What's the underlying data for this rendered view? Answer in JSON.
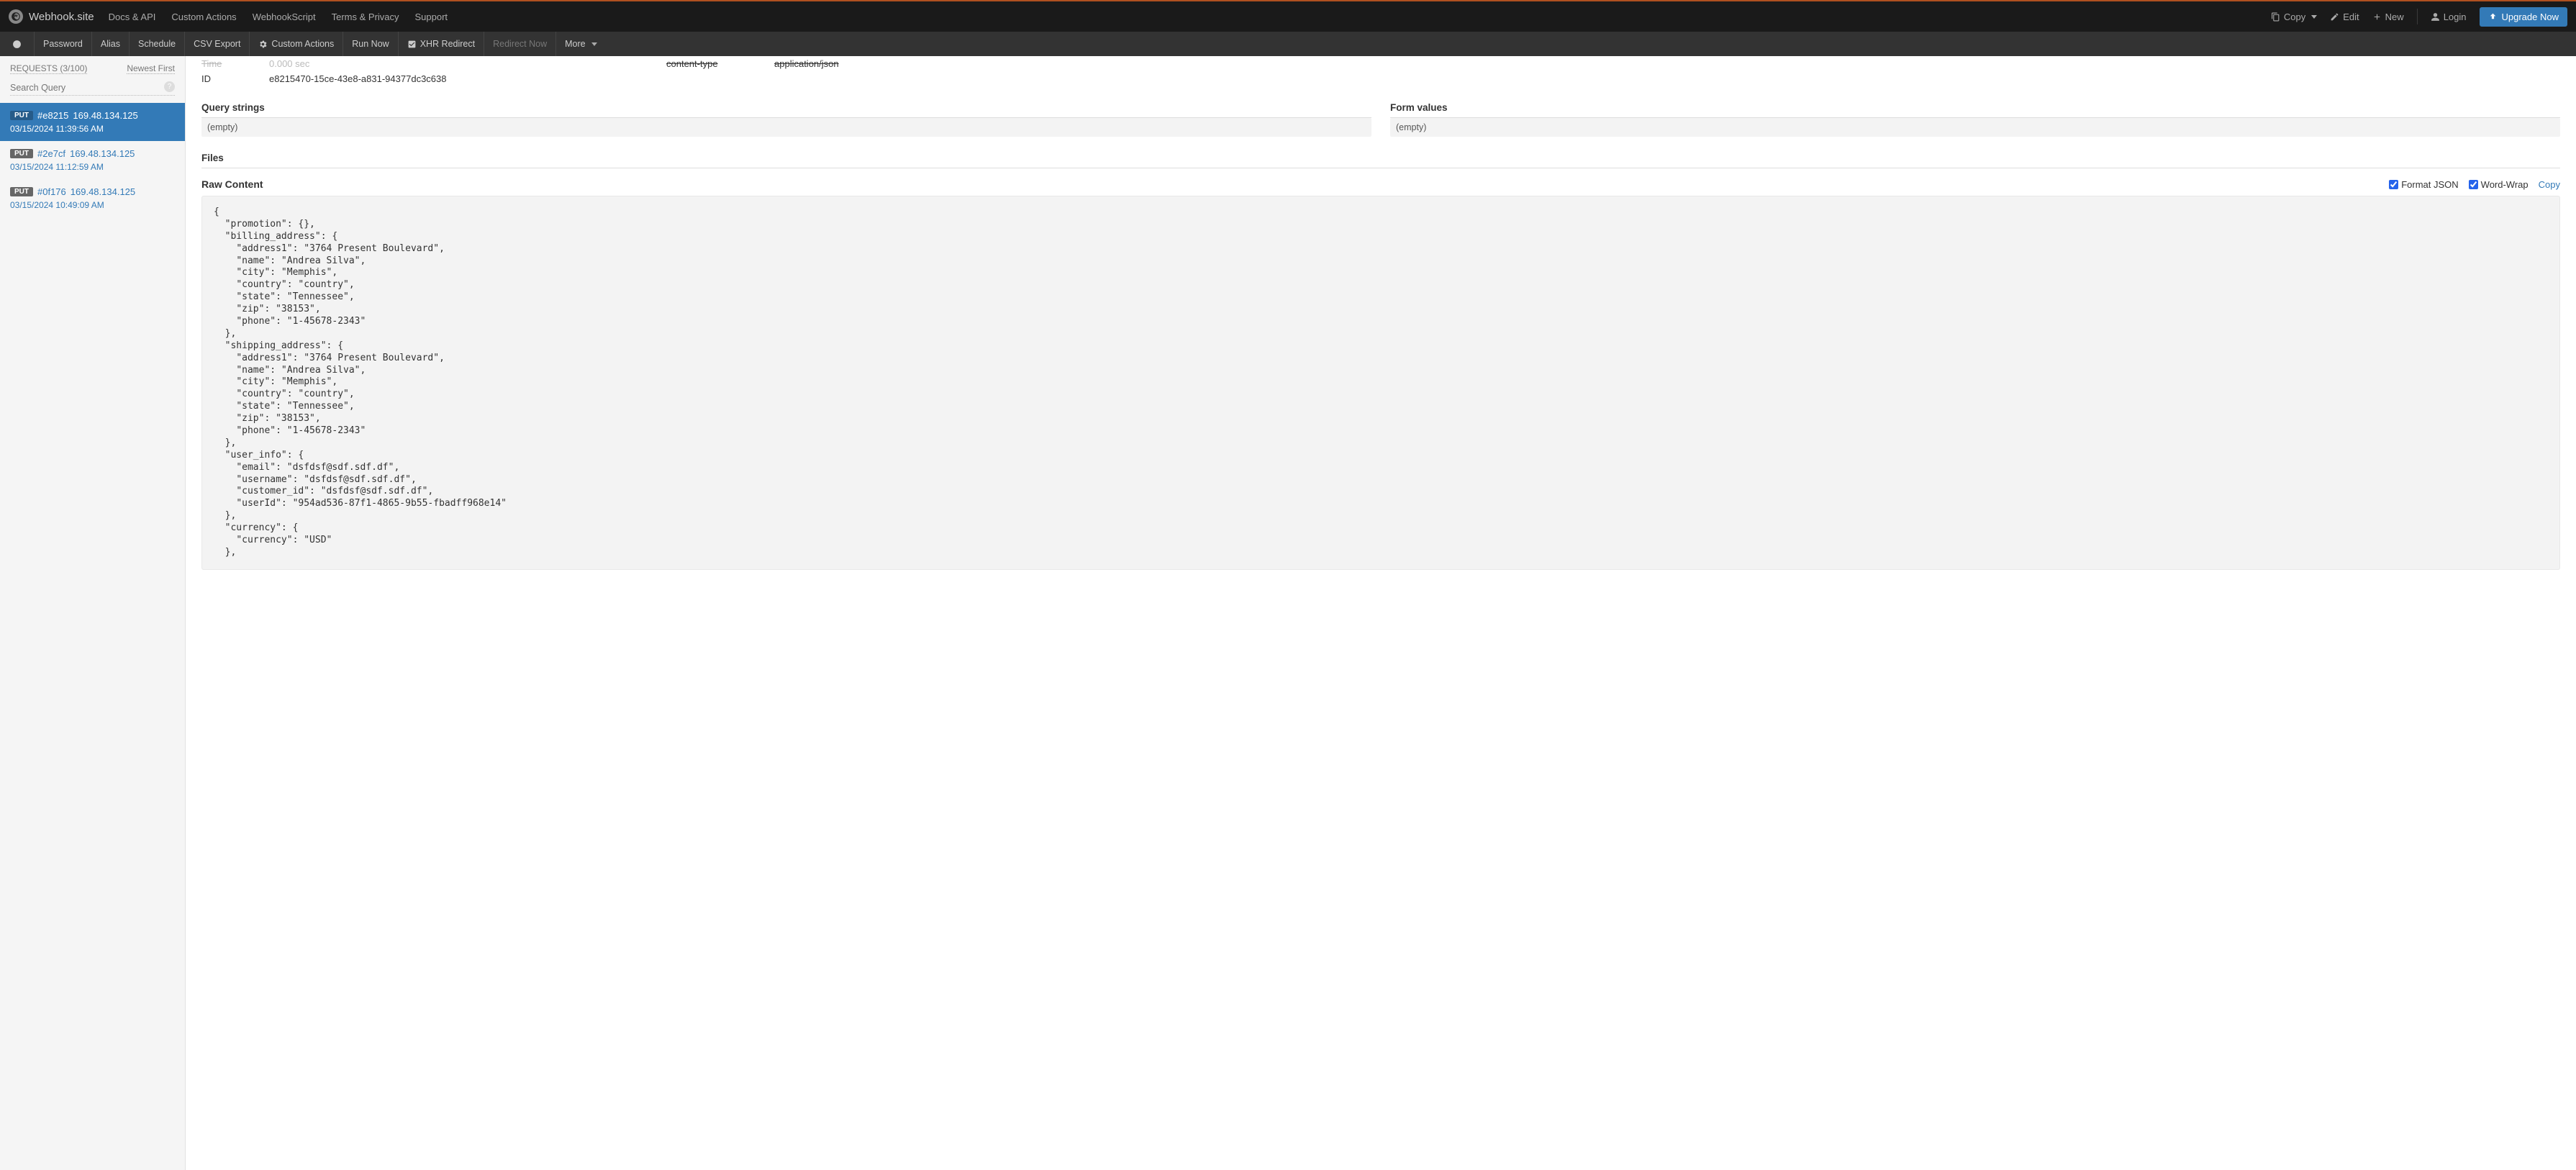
{
  "brand": "Webhook.site",
  "topnav": {
    "docs": "Docs & API",
    "custom_actions": "Custom Actions",
    "webhookscript": "WebhookScript",
    "terms": "Terms & Privacy",
    "support": "Support"
  },
  "topright": {
    "copy": "Copy",
    "edit": "Edit",
    "new": "New",
    "login": "Login",
    "upgrade": "Upgrade Now"
  },
  "secondbar": {
    "password": "Password",
    "alias": "Alias",
    "schedule": "Schedule",
    "csv_export": "CSV Export",
    "custom_actions": "Custom Actions",
    "run_now": "Run Now",
    "xhr_redirect": "XHR Redirect",
    "redirect_now": "Redirect Now",
    "more": "More"
  },
  "sidebar": {
    "requests_label": "REQUESTS (3/100)",
    "newest_first": "Newest First",
    "search_placeholder": "Search Query",
    "items": [
      {
        "method": "PUT",
        "hash": "#e8215",
        "ip": "169.48.134.125",
        "time": "03/15/2024 11:39:56 AM",
        "active": true
      },
      {
        "method": "PUT",
        "hash": "#2e7cf",
        "ip": "169.48.134.125",
        "time": "03/15/2024 11:12:59 AM",
        "active": false
      },
      {
        "method": "PUT",
        "hash": "#0f176",
        "ip": "169.48.134.125",
        "time": "03/15/2024 10:49:09 AM",
        "active": false
      }
    ]
  },
  "details": {
    "time_label": "Time",
    "time_value": "0.000 sec",
    "id_label": "ID",
    "id_value": "e8215470-15ce-43e8-a831-94377dc3c638",
    "content_type_label": "content-type",
    "content_type_value": "application/json"
  },
  "sections": {
    "query_strings": "Query strings",
    "query_empty": "(empty)",
    "form_values": "Form values",
    "form_empty": "(empty)",
    "files": "Files",
    "raw_content": "Raw Content",
    "format_json": "Format JSON",
    "word_wrap": "Word-Wrap",
    "copy": "Copy"
  },
  "raw_body": "{\n  \"promotion\": {},\n  \"billing_address\": {\n    \"address1\": \"3764 Present Boulevard\",\n    \"name\": \"Andrea Silva\",\n    \"city\": \"Memphis\",\n    \"country\": \"country\",\n    \"state\": \"Tennessee\",\n    \"zip\": \"38153\",\n    \"phone\": \"1-45678-2343\"\n  },\n  \"shipping_address\": {\n    \"address1\": \"3764 Present Boulevard\",\n    \"name\": \"Andrea Silva\",\n    \"city\": \"Memphis\",\n    \"country\": \"country\",\n    \"state\": \"Tennessee\",\n    \"zip\": \"38153\",\n    \"phone\": \"1-45678-2343\"\n  },\n  \"user_info\": {\n    \"email\": \"dsfdsf@sdf.sdf.df\",\n    \"username\": \"dsfdsf@sdf.sdf.df\",\n    \"customer_id\": \"dsfdsf@sdf.sdf.df\",\n    \"userId\": \"954ad536-87f1-4865-9b55-fbadff968e14\"\n  },\n  \"currency\": {\n    \"currency\": \"USD\"\n  },"
}
